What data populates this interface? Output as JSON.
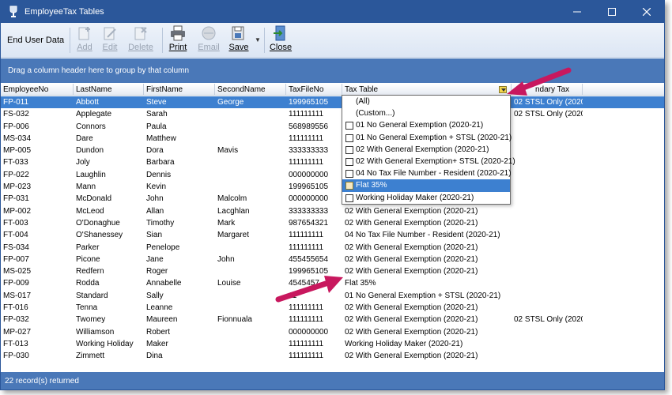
{
  "window": {
    "title": "EmployeeTax Tables"
  },
  "ribbon": {
    "end_user_data": "End User Data",
    "buttons": {
      "add": "Add",
      "edit": "Edit",
      "delete": "Delete",
      "print": "Print",
      "email": "Email",
      "save": "Save",
      "close": "Close"
    }
  },
  "group_panel": {
    "text": "Drag a column header here to group by that column"
  },
  "grid": {
    "columns": [
      "EmployeeNo",
      "LastName",
      "FirstName",
      "SecondName",
      "TaxFileNo",
      "Tax Table",
      "ndary Tax"
    ],
    "rows": [
      {
        "emp": "FP-011",
        "last": "Abbott",
        "first": "Steve",
        "second": "George",
        "tfn": "199965105",
        "table": "",
        "sec": "02 STSL Only (2020-"
      },
      {
        "emp": "FS-032",
        "last": "Applegate",
        "first": "Sarah",
        "second": "",
        "tfn": "111111111",
        "table": "",
        "sec": "02 STSL Only (2020-"
      },
      {
        "emp": "FP-006",
        "last": "Connors",
        "first": "Paula",
        "second": "",
        "tfn": "568989556",
        "table": "",
        "sec": ""
      },
      {
        "emp": "MS-034",
        "last": "Dare",
        "first": "Matthew",
        "second": "",
        "tfn": "111111111",
        "table": "",
        "sec": ""
      },
      {
        "emp": "MP-005",
        "last": "Dundon",
        "first": "Dora",
        "second": "Mavis",
        "tfn": "333333333",
        "table": "",
        "sec": ""
      },
      {
        "emp": "FT-033",
        "last": "Joly",
        "first": "Barbara",
        "second": "",
        "tfn": "111111111",
        "table": "",
        "sec": ""
      },
      {
        "emp": "FP-022",
        "last": "Laughlin",
        "first": "Dennis",
        "second": "",
        "tfn": "000000000",
        "table": "",
        "sec": ""
      },
      {
        "emp": "MP-023",
        "last": "Mann",
        "first": "Kevin",
        "second": "",
        "tfn": "199965105",
        "table": "",
        "sec": ""
      },
      {
        "emp": "FP-031",
        "last": "McDonald",
        "first": "John",
        "second": "Malcolm",
        "tfn": "000000000",
        "table": "",
        "sec": ""
      },
      {
        "emp": "MP-002",
        "last": "McLeod",
        "first": "Allan",
        "second": "Lacghlan",
        "tfn": "333333333",
        "table": "02 With General Exemption (2020-21)",
        "sec": ""
      },
      {
        "emp": "FT-003",
        "last": "O'Donaghue",
        "first": "Timothy",
        "second": "Mark",
        "tfn": "987654321",
        "table": "02 With General Exemption (2020-21)",
        "sec": ""
      },
      {
        "emp": "FT-004",
        "last": "O'Shanessey",
        "first": "Sian",
        "second": "Margaret",
        "tfn": "111111111",
        "table": "04 No Tax File Number - Resident (2020-21)",
        "sec": ""
      },
      {
        "emp": "FS-034",
        "last": "Parker",
        "first": "Penelope",
        "second": "",
        "tfn": "111111111",
        "table": "02 With General Exemption (2020-21)",
        "sec": ""
      },
      {
        "emp": "FP-007",
        "last": "Picone",
        "first": "Jane",
        "second": "John",
        "tfn": "455455654",
        "table": "02 With General Exemption (2020-21)",
        "sec": ""
      },
      {
        "emp": "MS-025",
        "last": "Redfern",
        "first": "Roger",
        "second": "",
        "tfn": "199965105",
        "table": "02 With General Exemption (2020-21)",
        "sec": ""
      },
      {
        "emp": "FP-009",
        "last": "Rodda",
        "first": "Annabelle",
        "second": "Louise",
        "tfn": "4545457",
        "table": "Flat 35%",
        "sec": ""
      },
      {
        "emp": "MS-017",
        "last": "Standard",
        "first": "Sally",
        "second": "",
        "tfn": "11",
        "table": "01 No General Exemption + STSL (2020-21)",
        "sec": ""
      },
      {
        "emp": "FT-016",
        "last": "Tenna",
        "first": "Leanne",
        "second": "",
        "tfn": "111111111",
        "table": "02 With General Exemption (2020-21)",
        "sec": ""
      },
      {
        "emp": "FP-032",
        "last": "Twomey",
        "first": "Maureen",
        "second": "Fionnuala",
        "tfn": "111111111",
        "table": "02 With General Exemption (2020-21)",
        "sec": "02 STSL Only (2020-"
      },
      {
        "emp": "MP-027",
        "last": "Williamson",
        "first": "Robert",
        "second": "",
        "tfn": "000000000",
        "table": "02 With General Exemption (2020-21)",
        "sec": ""
      },
      {
        "emp": "FT-013",
        "last": "Working Holiday",
        "first": "Maker",
        "second": "",
        "tfn": "111111111",
        "table": "Working Holiday Maker (2020-21)",
        "sec": ""
      },
      {
        "emp": "FP-030",
        "last": "Zimmett",
        "first": "Dina",
        "second": "",
        "tfn": "111111111",
        "table": "02 With General Exemption (2020-21)",
        "sec": ""
      }
    ]
  },
  "filter_dropdown": {
    "items": [
      {
        "label": "(All)",
        "checkbox": false
      },
      {
        "label": "(Custom...)",
        "checkbox": false
      },
      {
        "label": "01 No General Exemption (2020-21)",
        "checkbox": true
      },
      {
        "label": "01 No General Exemption + STSL (2020-21)",
        "checkbox": true
      },
      {
        "label": "02 With General Exemption (2020-21)",
        "checkbox": true
      },
      {
        "label": "02 With General Exemption+ STSL (2020-21)",
        "checkbox": true
      },
      {
        "label": "04 No Tax File Number - Resident (2020-21)",
        "checkbox": true
      },
      {
        "label": "Flat 35%",
        "checkbox": true
      },
      {
        "label": "Working Holiday Maker (2020-21)",
        "checkbox": true
      }
    ],
    "highlighted_index": 7
  },
  "status": {
    "text": "22 record(s) returned"
  },
  "colors": {
    "accent": "#2b579a",
    "panel": "#4a78b8",
    "selection": "#3d80d0",
    "annotation": "#c8185e"
  }
}
